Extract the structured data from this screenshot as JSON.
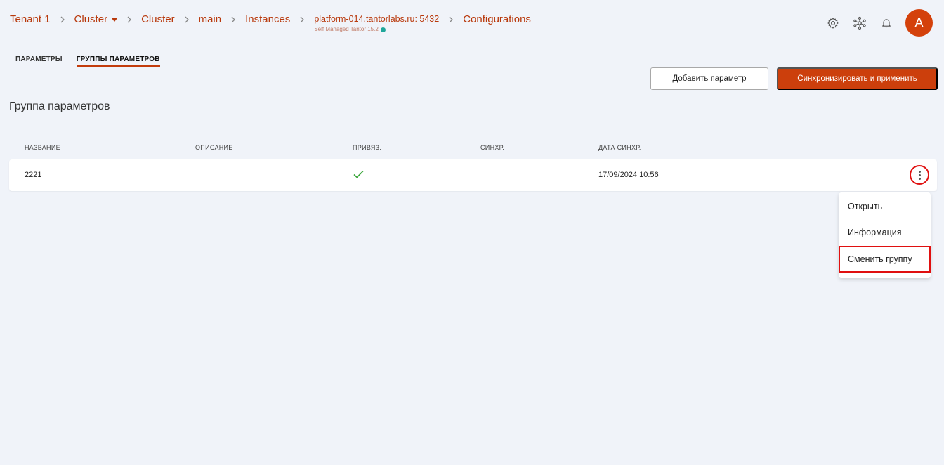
{
  "breadcrumb": {
    "tenant": "Tenant 1",
    "cluster_dropdown": "Cluster",
    "cluster": "Cluster",
    "main": "main",
    "instances": "Instances",
    "host": "platform-014.tantorlabs.ru: 5432",
    "host_sub": "Self Managed Tantor 15.2",
    "configurations": "Configurations"
  },
  "header": {
    "avatar_letter": "A"
  },
  "tabs": [
    {
      "label": "ПАРАМЕТРЫ",
      "active": false
    },
    {
      "label": "ГРУППЫ ПАРАМЕТРОВ",
      "active": true
    }
  ],
  "toolbar": {
    "add_label": "Добавить параметр",
    "sync_label": "Синхронизировать и применить"
  },
  "section_title": "Группа параметров",
  "table": {
    "columns": [
      "НАЗВАНИЕ",
      "ОПИСАНИЕ",
      "ПРИВЯЗ.",
      "СИНХР.",
      "ДАТА СИНХР."
    ],
    "rows": [
      {
        "name": "2221",
        "description": "",
        "bound": true,
        "synced": "",
        "sync_date": "17/09/2024 10:56"
      }
    ]
  },
  "context_menu": {
    "items": [
      "Открыть",
      "Информация",
      "Сменить группу"
    ],
    "highlighted": "Сменить группу"
  },
  "colors": {
    "accent": "#cc3f0c",
    "breadcrumb": "#b8380b",
    "check": "#3aa63a",
    "highlight": "#e01010"
  }
}
